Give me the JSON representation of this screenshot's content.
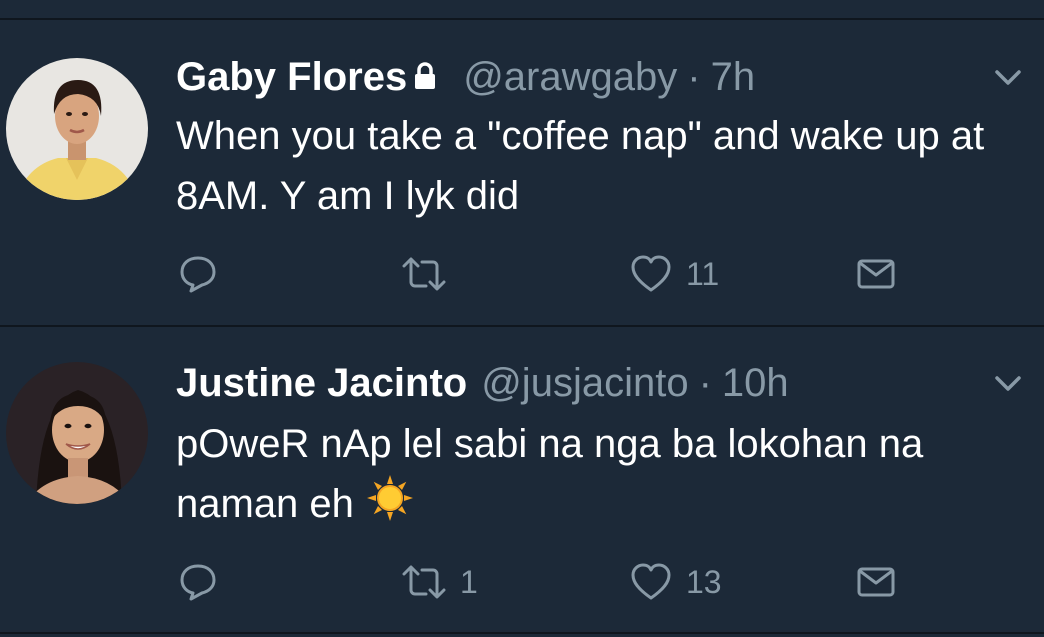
{
  "tweets": [
    {
      "display_name": "Gaby Flores",
      "protected": true,
      "handle": "@arawgaby",
      "separator": "·",
      "time": "7h",
      "text": "When you take a \"coffee nap\" and wake up at 8AM. Y am I lyk did",
      "reply_count": "",
      "retweet_count": "",
      "like_count": "11",
      "icons": [
        "lock-icon",
        "chevron-down-icon",
        "reply-icon",
        "retweet-icon",
        "like-heart-icon",
        "direct-message-icon"
      ]
    },
    {
      "display_name": "Justine Jacinto",
      "protected": false,
      "handle": "@jusjacinto",
      "separator": "·",
      "time": "10h",
      "text": "pOweR nAp lel sabi na nga ba lokohan na naman eh",
      "emoji": "sun-emoji",
      "reply_count": "",
      "retweet_count": "1",
      "like_count": "13",
      "icons": [
        "chevron-down-icon",
        "reply-icon",
        "retweet-icon",
        "like-heart-icon",
        "direct-message-icon"
      ]
    }
  ],
  "colors": {
    "background": "#1c2938",
    "divider": "#0f161e",
    "text": "#ffffff",
    "secondary": "#8899a6"
  }
}
